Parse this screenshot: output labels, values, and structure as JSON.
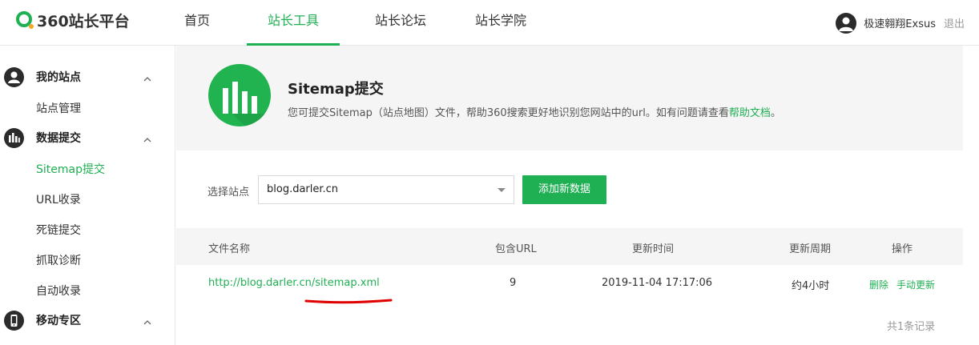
{
  "header": {
    "logo_text": "360站长平台",
    "nav": [
      {
        "label": "首页"
      },
      {
        "label": "站长工具"
      },
      {
        "label": "站长论坛"
      },
      {
        "label": "站长学院"
      }
    ],
    "active_nav": "站长工具",
    "user_name": "极速翱翔Exsus",
    "logout_label": "退出"
  },
  "sidebar": {
    "groups": [
      {
        "label": "我的站点",
        "icon": "user-icon",
        "items": [
          "站点管理"
        ]
      },
      {
        "label": "数据提交",
        "icon": "bar-chart-icon",
        "items": [
          "Sitemap提交",
          "URL收录",
          "死链提交",
          "抓取诊断",
          "自动收录"
        ]
      },
      {
        "label": "移动专区",
        "icon": "mobile-icon",
        "items": []
      }
    ],
    "active_item": "Sitemap提交"
  },
  "hero": {
    "title": "Sitemap提交",
    "desc_prefix": "您可提交Sitemap（站点地图）文件，帮助360搜索更好地识别您网站中的url。如有问题请查看",
    "desc_link": "帮助文档",
    "desc_suffix": "。"
  },
  "form": {
    "select_label": "选择站点",
    "selected_site": "blog.darler.cn",
    "add_button": "添加新数据"
  },
  "table": {
    "headers": [
      "文件名称",
      "包含URL",
      "更新时间",
      "更新周期",
      "操作"
    ],
    "rows": [
      {
        "file": "http://blog.darler.cn/sitemap.xml",
        "url_count": "9",
        "updated": "2019-11-04 17:17:06",
        "cycle": "约4小时",
        "actions": [
          "删除",
          "手动更新"
        ]
      }
    ],
    "total_text": "共1条记录"
  },
  "colors": {
    "accent": "#1fb053",
    "annotation": "#e00000"
  }
}
